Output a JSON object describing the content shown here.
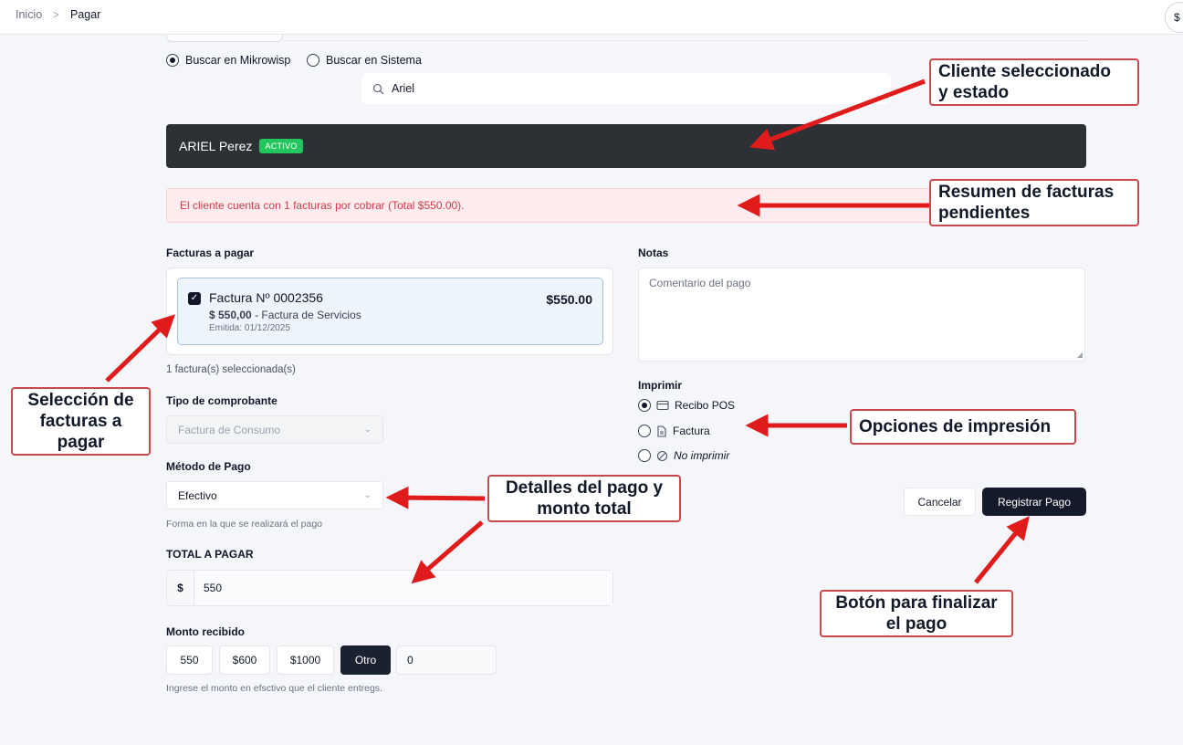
{
  "breadcrumb": {
    "home": "Inicio",
    "separator": ">",
    "current": "Pagar"
  },
  "topbar": {
    "right_button": "$"
  },
  "search": {
    "option_mikrowisp": "Buscar en Mikrowisp",
    "option_sistema": "Buscar en Sistema",
    "selected_option": "Buscar en Mikrowisp",
    "value": "Ariel"
  },
  "client": {
    "name": "ARIEL Perez",
    "status": "ACTIVO",
    "status_color": "#22c55e"
  },
  "alert": {
    "message": "El cliente cuenta con 1 facturas por cobrar (Total $550.00)."
  },
  "invoices": {
    "label": "Facturas a pagar",
    "items": [
      {
        "title": "Factura Nº 0002356",
        "amount": "$550.00",
        "detail_amount": "$ 550,00",
        "detail_type": "- Factura de Servicios",
        "date": "Emitida: 01/12/2025",
        "checked": true
      }
    ],
    "selected_count": "1 factura(s) seleccionada(s)"
  },
  "comprobante": {
    "label": "Tipo de comprobante",
    "value": "Factura de Consumo"
  },
  "metodo": {
    "label": "Método de Pago",
    "value": "Efectivo",
    "hint": "Forma en la que se realizará el pago"
  },
  "total": {
    "label": "TOTAL A PAGAR",
    "currency": "$",
    "value": "550"
  },
  "monto": {
    "label": "Monto recibido",
    "buttons": [
      "550",
      "$600",
      "$1000",
      "Otro"
    ],
    "selected": "Otro",
    "input_value": "0",
    "hint": "Ingrese el monto en efsctivo que el cliente entregs."
  },
  "notas": {
    "label": "Notas",
    "placeholder": "Comentario del pago"
  },
  "imprimir": {
    "label": "Imprimir",
    "options": [
      "Recibo POS",
      "Factura",
      "No imprimir"
    ],
    "selected": "Recibo POS"
  },
  "actions": {
    "cancel": "Cancelar",
    "submit": "Registrar Pago"
  },
  "callouts": {
    "cliente_1": "Cliente seleccionado",
    "cliente_2": "y estado",
    "resumen_1": "Resumen de facturas",
    "resumen_2": "pendientes",
    "seleccion_1": "Selección de",
    "seleccion_2": "facturas a",
    "seleccion_3": "pagar",
    "opciones": "Opciones de impresión",
    "detalles_1": "Detalles del pago y",
    "detalles_2": "monto total",
    "boton_1": "Botón para finalizar",
    "boton_2": "el pago"
  },
  "colors": {
    "accent_dark": "#141a2a",
    "callout_border": "#c9484b",
    "arrow": "#e01b1b",
    "alert_text": "#d03c4a"
  }
}
